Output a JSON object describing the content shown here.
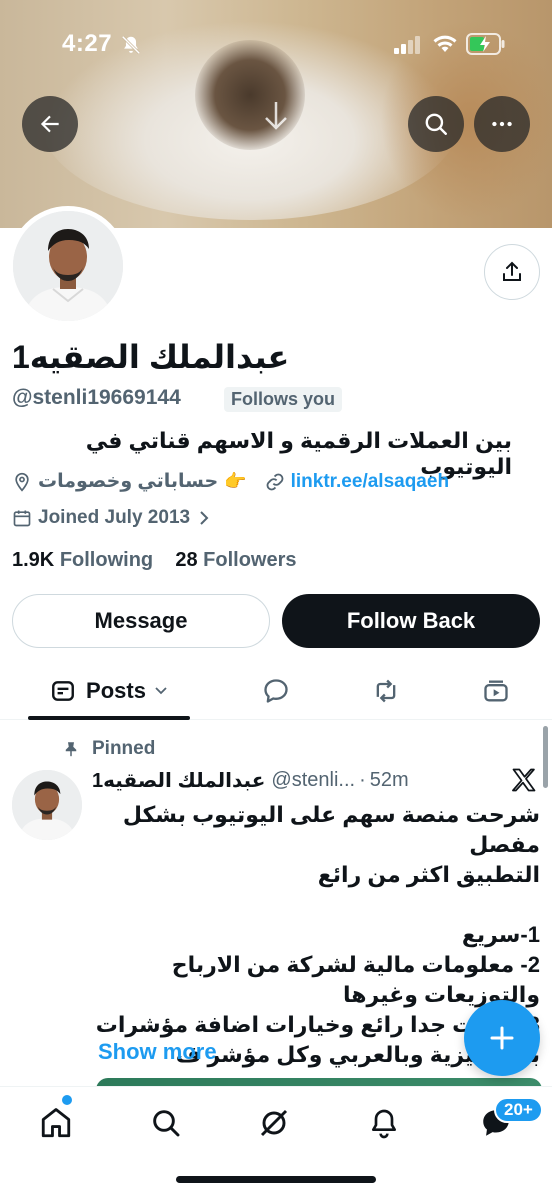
{
  "status_bar": {
    "time": "4:27"
  },
  "profile": {
    "display_name": "عبدالملك الصقيه1",
    "handle": "@stenli19669144",
    "follows_you_label": "Follows you",
    "bio": "بين العملات الرقمية و الاسهم قناتي في اليوتيوب",
    "location": "حساباتي وخصومات",
    "location_emoji": "👉",
    "link": "linktr.ee/alsaqaeh",
    "joined": "Joined July 2013",
    "following_count": "1.9K",
    "following_label": "Following",
    "followers_count": "28",
    "followers_label": "Followers"
  },
  "actions": {
    "message_label": "Message",
    "follow_back_label": "Follow Back"
  },
  "tabs": {
    "posts_label": "Posts"
  },
  "pinned_post": {
    "pinned_label": "Pinned",
    "author_name": "عبدالملك الصقيه1",
    "author_handle": "@stenli...",
    "separator": "·",
    "time": "52m",
    "text": "شرحت منصة سهم على اليوتيوب بشكل\nمفصل\nالتطبيق اكثر من رائع\n\n1-سريع\n2- معلومات مالية لشركة من الارباح\nوالتوزيعات وغيرها\n3- ادوات جدا رائع وخيارات اضافة مؤشرات\nبالانجليزية وبالعربي وكل مؤشر ف",
    "show_more_label": "Show more"
  },
  "bottom_nav": {
    "messages_badge": "20+"
  },
  "colors": {
    "accent": "#1d9bf0",
    "text_primary": "#0f1419",
    "text_secondary": "#536471",
    "follow_button_bg": "#0f1419"
  }
}
